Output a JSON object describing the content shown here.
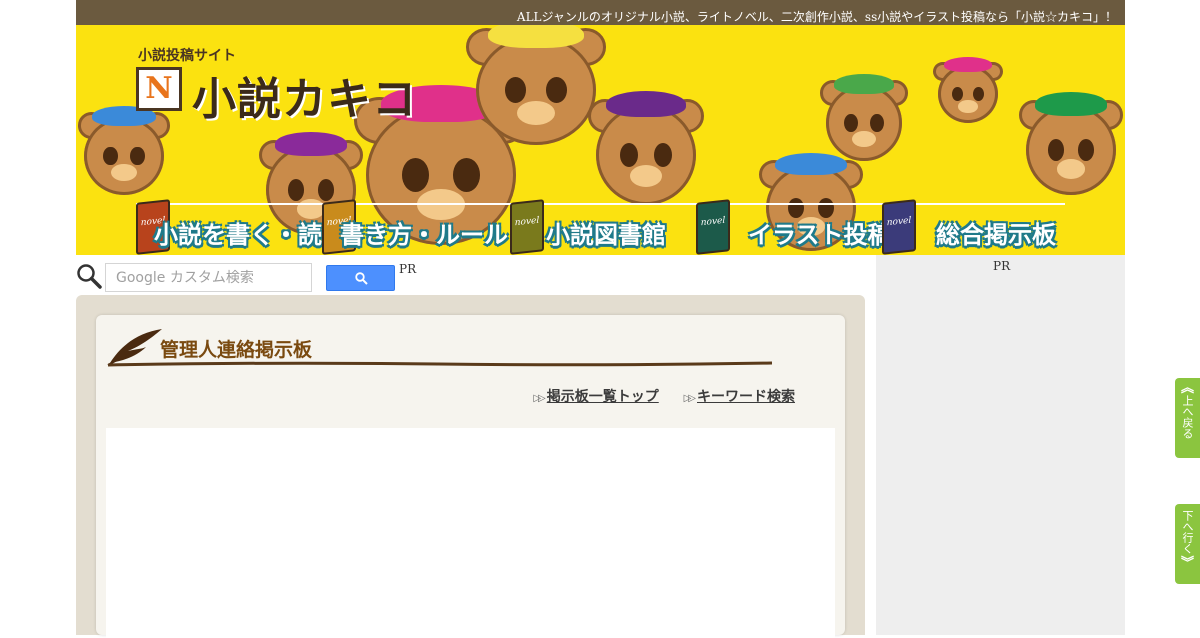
{
  "header": {
    "tagline": "ALLジャンルのオリジナル小説、ライトノベル、二次創作小説、ss小説やイラスト投稿なら「小説☆カキコ」！",
    "logo_subtitle": "小説投稿サイト",
    "logo_mark": "N",
    "logo_title": "小説カキコ"
  },
  "nav": {
    "items": [
      {
        "label": "小説を書く・読む",
        "book_color": "#b8431c",
        "book_text": "novel"
      },
      {
        "label": "書き方・ルール",
        "book_color": "#c98b1c",
        "book_text": "novel"
      },
      {
        "label": "小説図書館",
        "book_color": "#7a7a1c",
        "book_text": "novel"
      },
      {
        "label": "イラスト投稿",
        "book_color": "#1c5a4a",
        "book_text": "novel"
      },
      {
        "label": "総合掲示板",
        "book_color": "#3b3b7a",
        "book_text": "novel"
      }
    ]
  },
  "search": {
    "placeholder": "Google カスタム検索",
    "pr_label": "PR"
  },
  "main": {
    "title": "管理人連絡掲示板",
    "links": [
      {
        "label": "掲示板一覧トップ"
      },
      {
        "label": "キーワード検索"
      }
    ]
  },
  "sidebar": {
    "pr_label": "PR"
  },
  "floating": {
    "up_label": "上へ戻る",
    "down_label": "下へ行く"
  },
  "colors": {
    "banner_bg": "#fbe210",
    "topbar_bg": "#6b5a3f",
    "nav_outline": "#1f7a8a",
    "float_btn": "#8bc53f",
    "title_color": "#7a4a10"
  }
}
